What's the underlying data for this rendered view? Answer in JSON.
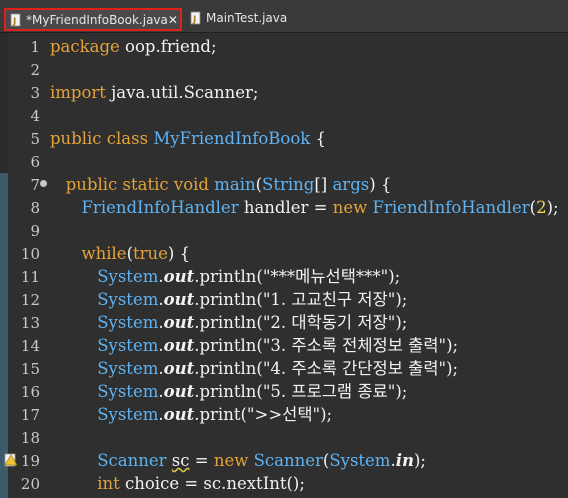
{
  "tabs": [
    {
      "label": "*MyFriendInfoBook.java",
      "icon": "java-file-icon",
      "active": true,
      "close": "✕"
    },
    {
      "label": "MainTest.java",
      "icon": "java-file-icon",
      "active": false
    }
  ],
  "lines": [
    {
      "n": "1",
      "segments": [
        [
          "kw",
          "package"
        ],
        [
          "plain",
          " oop.friend;"
        ]
      ]
    },
    {
      "n": "2",
      "segments": []
    },
    {
      "n": "3",
      "segments": [
        [
          "kw",
          "import"
        ],
        [
          "plain",
          " java.util.Scanner;"
        ]
      ]
    },
    {
      "n": "4",
      "segments": []
    },
    {
      "n": "5",
      "segments": [
        [
          "kw",
          "public class "
        ],
        [
          "type",
          "MyFriendInfoBook"
        ],
        [
          "plain",
          " {"
        ]
      ]
    },
    {
      "n": "6",
      "segments": []
    },
    {
      "n": "7",
      "segments": [
        [
          "plain",
          "   "
        ],
        [
          "kw",
          "public static void "
        ],
        [
          "type",
          "main"
        ],
        [
          "plain",
          "("
        ],
        [
          "type",
          "String"
        ],
        [
          "plain",
          "[] "
        ],
        [
          "type",
          "args"
        ],
        [
          "plain",
          ") {"
        ]
      ]
    },
    {
      "n": "8",
      "segments": [
        [
          "plain",
          "      "
        ],
        [
          "type",
          "FriendInfoHandler"
        ],
        [
          "plain",
          " handler = "
        ],
        [
          "kw",
          "new "
        ],
        [
          "type",
          "FriendInfoHandler"
        ],
        [
          "plain",
          "("
        ],
        [
          "num",
          "2"
        ],
        [
          "plain",
          ");"
        ]
      ]
    },
    {
      "n": "9",
      "segments": []
    },
    {
      "n": "10",
      "segments": [
        [
          "plain",
          "      "
        ],
        [
          "kw",
          "while"
        ],
        [
          "plain",
          "("
        ],
        [
          "kw",
          "true"
        ],
        [
          "plain",
          ") {"
        ]
      ]
    },
    {
      "n": "11",
      "segments": [
        [
          "plain",
          "         "
        ],
        [
          "type",
          "System"
        ],
        [
          "plain",
          "."
        ],
        [
          "out",
          "out"
        ],
        [
          "plain",
          ".println("
        ],
        [
          "str",
          "\"***메뉴선택***\""
        ],
        [
          "plain",
          ");"
        ]
      ]
    },
    {
      "n": "12",
      "segments": [
        [
          "plain",
          "         "
        ],
        [
          "type",
          "System"
        ],
        [
          "plain",
          "."
        ],
        [
          "out",
          "out"
        ],
        [
          "plain",
          ".println("
        ],
        [
          "str",
          "\"1. 고교친구 저장\""
        ],
        [
          "plain",
          ");"
        ]
      ]
    },
    {
      "n": "13",
      "segments": [
        [
          "plain",
          "         "
        ],
        [
          "type",
          "System"
        ],
        [
          "plain",
          "."
        ],
        [
          "out",
          "out"
        ],
        [
          "plain",
          ".println("
        ],
        [
          "str",
          "\"2. 대학동기 저장\""
        ],
        [
          "plain",
          ");"
        ]
      ]
    },
    {
      "n": "14",
      "segments": [
        [
          "plain",
          "         "
        ],
        [
          "type",
          "System"
        ],
        [
          "plain",
          "."
        ],
        [
          "out",
          "out"
        ],
        [
          "plain",
          ".println("
        ],
        [
          "str",
          "\"3. 주소록 전체정보 출력\""
        ],
        [
          "plain",
          ");"
        ]
      ]
    },
    {
      "n": "15",
      "segments": [
        [
          "plain",
          "         "
        ],
        [
          "type",
          "System"
        ],
        [
          "plain",
          "."
        ],
        [
          "out",
          "out"
        ],
        [
          "plain",
          ".println("
        ],
        [
          "str",
          "\"4. 주소록 간단정보 출력\""
        ],
        [
          "plain",
          ");"
        ]
      ]
    },
    {
      "n": "16",
      "segments": [
        [
          "plain",
          "         "
        ],
        [
          "type",
          "System"
        ],
        [
          "plain",
          "."
        ],
        [
          "out",
          "out"
        ],
        [
          "plain",
          ".println("
        ],
        [
          "str",
          "\"5. 프로그램 종료\""
        ],
        [
          "plain",
          ");"
        ]
      ]
    },
    {
      "n": "17",
      "segments": [
        [
          "plain",
          "         "
        ],
        [
          "type",
          "System"
        ],
        [
          "plain",
          "."
        ],
        [
          "out",
          "out"
        ],
        [
          "plain",
          ".print("
        ],
        [
          "str",
          "\">>선택\""
        ],
        [
          "plain",
          ");"
        ]
      ]
    },
    {
      "n": "18",
      "segments": []
    },
    {
      "n": "19",
      "segments": [
        [
          "plain",
          "         "
        ],
        [
          "type",
          "Scanner"
        ],
        [
          "plain",
          " "
        ],
        [
          "warn",
          "sc"
        ],
        [
          "plain",
          " = "
        ],
        [
          "kw",
          "new "
        ],
        [
          "type",
          "Scanner"
        ],
        [
          "plain",
          "("
        ],
        [
          "type",
          "System"
        ],
        [
          "plain",
          "."
        ],
        [
          "out",
          "in"
        ],
        [
          "plain",
          ");"
        ]
      ]
    },
    {
      "n": "20",
      "segments": [
        [
          "plain",
          "         "
        ],
        [
          "kw",
          "int"
        ],
        [
          "plain",
          " choice = sc.nextInt();"
        ]
      ]
    }
  ]
}
